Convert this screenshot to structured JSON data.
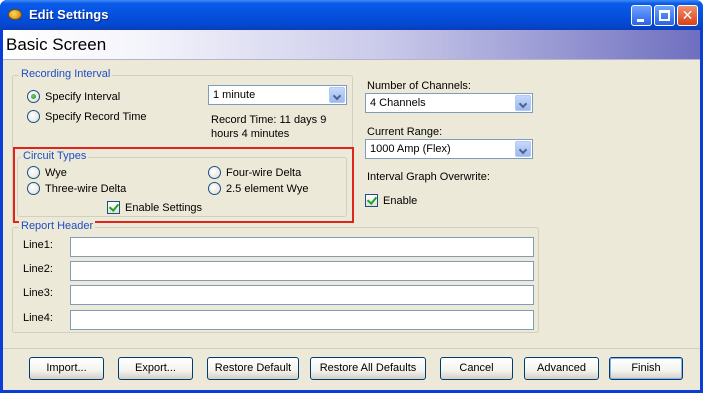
{
  "window": {
    "title": "Edit Settings"
  },
  "banner": {
    "title": "Basic Screen"
  },
  "recording_interval": {
    "label": "Recording Interval",
    "options": [
      "Specify Interval",
      "Specify Record Time"
    ],
    "selected": "Specify Interval",
    "interval_value": "1 minute",
    "record_time_line1": "Record Time: 11 days 9",
    "record_time_line2": "hours 4 minutes"
  },
  "circuit_types": {
    "label": "Circuit Types",
    "options": [
      "Wye",
      "Four-wire Delta",
      "Three-wire Delta",
      "2.5 element Wye"
    ],
    "enable_label": "Enable Settings",
    "enable_checked": true
  },
  "channels": {
    "label": "Number of Channels:",
    "value": "4 Channels"
  },
  "current_range": {
    "label": "Current Range:",
    "value": "1000 Amp (Flex)"
  },
  "overwrite": {
    "label": "Interval Graph Overwrite:",
    "enable_label": "Enable",
    "enable_checked": true
  },
  "report_header": {
    "label": "Report Header",
    "lines": [
      {
        "label": "Line1:",
        "value": ""
      },
      {
        "label": "Line2:",
        "value": ""
      },
      {
        "label": "Line3:",
        "value": ""
      },
      {
        "label": "Line4:",
        "value": ""
      }
    ]
  },
  "buttons": {
    "import": "Import...",
    "export": "Export...",
    "restore_default": "Restore Default",
    "restore_all": "Restore All Defaults",
    "cancel": "Cancel",
    "advanced": "Advanced",
    "finish": "Finish"
  },
  "colors": {
    "title_bar": "#0552e1",
    "group_label": "#1f4ec4",
    "highlight": "#e0241b"
  },
  "icons": [
    "app-icon",
    "minimize-icon",
    "maximize-icon",
    "close-icon",
    "chevron-down-icon"
  ]
}
